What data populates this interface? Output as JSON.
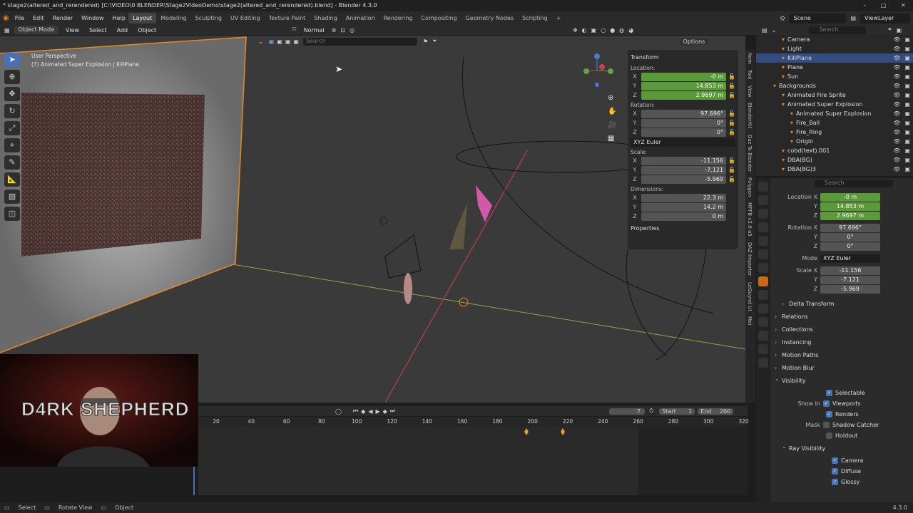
{
  "titlebar": {
    "title": "* stage2(altered_and_rerendered) [C:\\VIDEO\\0 BLENDER\\Stage2VideoDemo\\stage2(altered_and_rerendered).blend] - Blender 4.3.0"
  },
  "menu": {
    "file": "File",
    "edit": "Edit",
    "render": "Render",
    "window": "Window",
    "help": "Help"
  },
  "workspaces": [
    "Layout",
    "Modeling",
    "Sculpting",
    "UV Editing",
    "Texture Paint",
    "Shading",
    "Animation",
    "Rendering",
    "Compositing",
    "Geometry Nodes",
    "Scripting"
  ],
  "scene": {
    "name": "Scene",
    "view_layer": "ViewLayer"
  },
  "viewport_header": {
    "mode": "Object Mode",
    "view": "View",
    "select": "Select",
    "add": "Add",
    "object": "Object",
    "orientation": "Normal",
    "search_placeholder": "Search",
    "options": "Options"
  },
  "viewport_info": {
    "line1": "User Perspective",
    "line2": "(7) Animated Super Explosion | KillPlane"
  },
  "npanel": {
    "transform": "Transform",
    "location_label": "Location:",
    "location": {
      "x": "-0 m",
      "y": "14.853 m",
      "z": "2.9697 m"
    },
    "rotation_label": "Rotation:",
    "rotation": {
      "x": "97.696°",
      "y": "0°",
      "z": "0°"
    },
    "rotation_mode": "XYZ Euler",
    "scale_label": "Scale:",
    "scale": {
      "x": "-11.156",
      "y": "-7.121",
      "z": "-5.969"
    },
    "dimensions_label": "Dimensions:",
    "dimensions": {
      "x": "22.3 m",
      "y": "14.2 m",
      "z": "0 m"
    },
    "properties": "Properties",
    "axes": {
      "x": "X",
      "y": "Y",
      "z": "Z"
    }
  },
  "ntabs": [
    "Item",
    "Tool",
    "View",
    "BlenderKit",
    "Daz To Blender",
    "Polygon",
    "MPFB v2.0-a5",
    "DAZ Importer",
    "LeGuynd UI",
    "Mei"
  ],
  "timeline": {
    "current_frame": "7",
    "start_label": "Start",
    "start": "1",
    "end_label": "End",
    "end": "260",
    "ticks": [
      "20",
      "40",
      "60",
      "80",
      "100",
      "120",
      "140",
      "160",
      "180",
      "200",
      "220",
      "240",
      "260",
      "280",
      "300",
      "320"
    ]
  },
  "webcam": {
    "overlay_text": "D4RK SHEPHERD"
  },
  "statusbar": {
    "select": "Select",
    "rotate": "Rotate View",
    "object": "Object",
    "version": "4.3.0"
  },
  "outliner": {
    "search_placeholder": "Search",
    "rows": [
      {
        "label": "Camera",
        "indent": 3,
        "sel": false
      },
      {
        "label": "Light",
        "indent": 3,
        "sel": false
      },
      {
        "label": "KillPlane",
        "indent": 3,
        "sel": true
      },
      {
        "label": "Plane",
        "indent": 3,
        "sel": false
      },
      {
        "label": "Sun",
        "indent": 3,
        "sel": false
      },
      {
        "label": "Backgrounds",
        "indent": 2,
        "sel": false
      },
      {
        "label": "Animated Fire Sprite",
        "indent": 3,
        "sel": false
      },
      {
        "label": "Animated Super Explosion",
        "indent": 3,
        "sel": false
      },
      {
        "label": "Animated Super Explosion",
        "indent": 4,
        "sel": false
      },
      {
        "label": "Fire_Ball",
        "indent": 4,
        "sel": false
      },
      {
        "label": "Fire_Ring",
        "indent": 4,
        "sel": false
      },
      {
        "label": "Origin",
        "indent": 4,
        "sel": false
      },
      {
        "label": "cobd(text).001",
        "indent": 3,
        "sel": false
      },
      {
        "label": "DBA(BG)",
        "indent": 3,
        "sel": false
      },
      {
        "label": "DBA(BG)3",
        "indent": 3,
        "sel": false
      }
    ]
  },
  "properties": {
    "search_placeholder": "Search",
    "location_x_label": "Location X",
    "location": {
      "x": "-0 m",
      "y": "14.853 m",
      "z": "2.9697 m"
    },
    "rotation_x_label": "Rotation X",
    "rotation": {
      "x": "97.696°",
      "y": "0°",
      "z": "0°"
    },
    "mode_label": "Mode",
    "mode": "XYZ Euler",
    "scale_x_label": "Scale X",
    "scale": {
      "x": "-11.156",
      "y": "-7.121",
      "z": "-5.969"
    },
    "y": "Y",
    "z": "Z",
    "sections": {
      "delta": "Delta Transform",
      "relations": "Relations",
      "collections": "Collections",
      "instancing": "Instancing",
      "motion_paths": "Motion Paths",
      "motion_blur": "Motion Blur",
      "visibility": "Visibility",
      "ray_visibility": "Ray Visibility"
    },
    "selectable": "Selectable",
    "show_in_label": "Show In",
    "viewports": "Viewports",
    "renders": "Renders",
    "mask_label": "Mask",
    "shadow_catcher": "Shadow Catcher",
    "holdout": "Holdout",
    "camera": "Camera",
    "diffuse": "Diffuse",
    "glossy": "Glossy"
  },
  "colors": {
    "accent": "#4772b3",
    "field_green": "#5b9a3a",
    "selection": "#334d80",
    "object_orange": "#e8891f"
  }
}
